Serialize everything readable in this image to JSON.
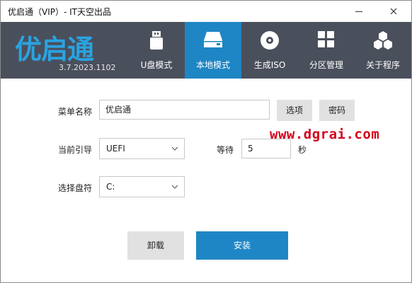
{
  "window": {
    "title": "优启通（VIP）- IT天空出品",
    "minimize_glyph": "—",
    "close_glyph": "✕"
  },
  "brand": {
    "logo_text": "优启通",
    "version": "3.7.2023.1102",
    "logo_color": "#2aa3e0"
  },
  "tabs": [
    {
      "label": "U盘模式",
      "icon": "usb-drive-icon",
      "active": false
    },
    {
      "label": "本地模式",
      "icon": "hard-drive-icon",
      "active": true
    },
    {
      "label": "生成ISO",
      "icon": "disc-icon",
      "active": false
    },
    {
      "label": "分区管理",
      "icon": "grid-icon",
      "active": false
    },
    {
      "label": "关于程序",
      "icon": "hexagons-icon",
      "active": false
    }
  ],
  "form": {
    "menu_name_label": "菜单名称",
    "menu_name_value": "优启通",
    "options_button": "选项",
    "password_button": "密码",
    "boot_label": "当前引导",
    "boot_value": "UEFI",
    "wait_label": "等待",
    "wait_value": "5",
    "wait_unit": "秒",
    "drive_label": "选择盘符",
    "drive_value": "C:"
  },
  "actions": {
    "uninstall": "卸载",
    "install": "安装"
  },
  "watermark": "www.dgrai.com",
  "colors": {
    "header_bg": "#4a4f5c",
    "active_tab": "#1e86c4",
    "primary_button": "#1f86c5",
    "watermark": "#d4001a"
  }
}
